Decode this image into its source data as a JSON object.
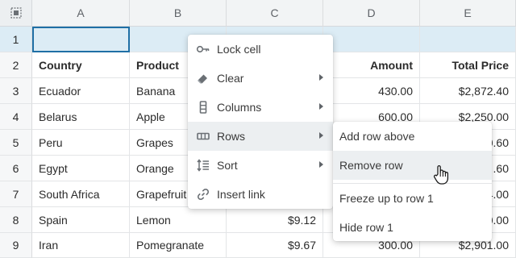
{
  "columns": [
    "A",
    "B",
    "C",
    "D",
    "E"
  ],
  "rows": [
    {
      "num": "1",
      "cells": [
        "",
        "",
        "",
        "",
        ""
      ]
    },
    {
      "num": "2",
      "cells": [
        "Country",
        "Product",
        "",
        "Amount",
        "Total Price"
      ]
    },
    {
      "num": "3",
      "cells": [
        "Ecuador",
        "Banana",
        "",
        "430.00",
        "$2,872.40"
      ]
    },
    {
      "num": "4",
      "cells": [
        "Belarus",
        "Apple",
        "",
        "600.00",
        "$2,250.00"
      ]
    },
    {
      "num": "5",
      "cells": [
        "Peru",
        "Grapes",
        "",
        "",
        "0.60"
      ]
    },
    {
      "num": "6",
      "cells": [
        "Egypt",
        "Orange",
        "",
        "",
        ".60"
      ]
    },
    {
      "num": "7",
      "cells": [
        "South Africa",
        "Grapefruit",
        "",
        "",
        "4.00"
      ]
    },
    {
      "num": "8",
      "cells": [
        "Spain",
        "Lemon",
        "$9.12",
        "",
        "0.00"
      ]
    },
    {
      "num": "9",
      "cells": [
        "Iran",
        "Pomegranate",
        "$9.67",
        "300.00",
        "$2,901.00"
      ]
    }
  ],
  "context_menu": {
    "items": [
      {
        "label": "Lock cell",
        "icon": "key-icon",
        "submenu": false
      },
      {
        "label": "Clear",
        "icon": "eraser-icon",
        "submenu": true
      },
      {
        "label": "Columns",
        "icon": "columns-icon",
        "submenu": true
      },
      {
        "label": "Rows",
        "icon": "rows-icon",
        "submenu": true
      },
      {
        "label": "Sort",
        "icon": "sort-icon",
        "submenu": true
      },
      {
        "label": "Insert link",
        "icon": "link-icon",
        "submenu": false
      }
    ],
    "highlighted": "Rows"
  },
  "rows_submenu": {
    "items": [
      "Add row above",
      "Remove row",
      "Freeze up to row 1",
      "Hide row 1"
    ],
    "highlighted": "Remove row"
  },
  "colors": {
    "selection": "#dcecf5",
    "active_border": "#1f6fa5",
    "menu_hover": "#eceff1"
  }
}
